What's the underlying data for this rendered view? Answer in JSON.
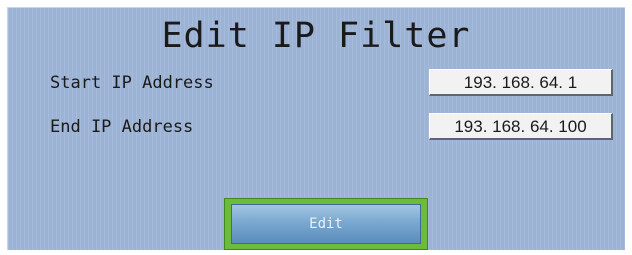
{
  "dialog": {
    "title": "Edit IP Filter",
    "start_label": "Start IP Address",
    "start_value": "193. 168. 64. 1",
    "end_label": "End IP Address",
    "end_value": "193. 168. 64. 100",
    "edit_label": "Edit"
  },
  "colors": {
    "panel_background": "#9cb3d6",
    "button_focus_border": "#6dbb3a",
    "button_fill": "#7aa8d0"
  }
}
